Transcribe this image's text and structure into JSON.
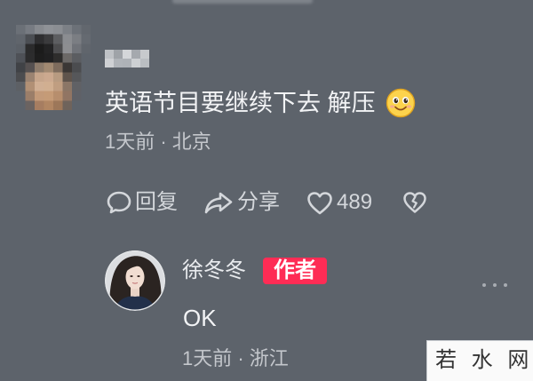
{
  "colors": {
    "bg": "#5d636b",
    "primary": "#f2f3f5",
    "secondary": "#c4c7cc",
    "action": "#d4d7db",
    "badge": "#fe2c55"
  },
  "comment": {
    "avatar_icon": "pixelated-avatar",
    "username_icon": "pixelated-username",
    "text": "英语节目要继续下去 解压",
    "emoji_icon": "smiling-face-emoji",
    "meta": "1天前 · 北京",
    "actions": {
      "reply": {
        "icon": "comment-bubble-icon",
        "label": "回复"
      },
      "share": {
        "icon": "share-arrow-icon",
        "label": "分享"
      },
      "like": {
        "icon": "heart-icon",
        "count": "489"
      },
      "dislike": {
        "icon": "broken-heart-icon"
      }
    }
  },
  "reply": {
    "author_name": "徐冬冬",
    "badge": "作者",
    "text": "OK",
    "meta": "1天前 · 浙江",
    "more_icon": "more-dots-icon"
  },
  "watermark": {
    "text": "若 水 网"
  }
}
